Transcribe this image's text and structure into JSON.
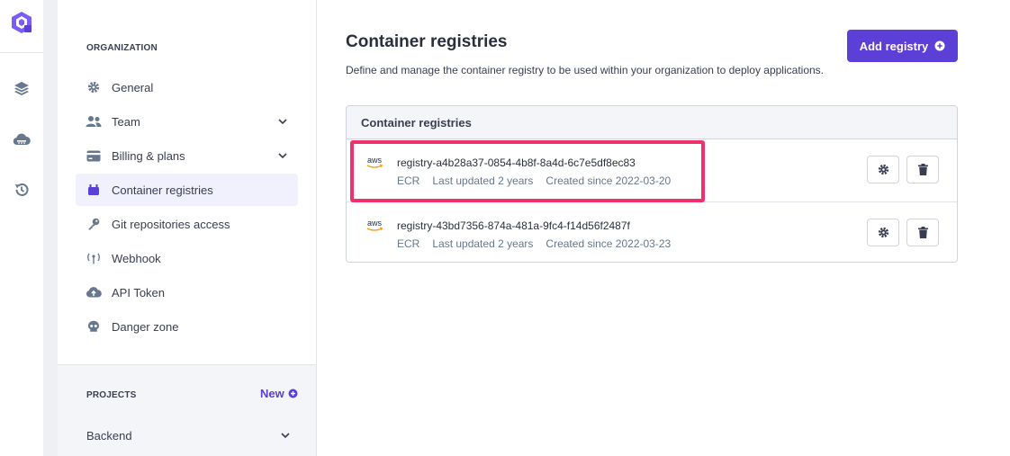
{
  "rail": {
    "logo_icon": "qovery-logo-icon",
    "items": [
      {
        "name": "layers-icon"
      },
      {
        "name": "cloud-icon"
      },
      {
        "name": "history-icon"
      }
    ]
  },
  "sidebar": {
    "organization_title": "Organization",
    "items": [
      {
        "label": "General",
        "icon": "gear-icon",
        "expandable": false,
        "active": false
      },
      {
        "label": "Team",
        "icon": "users-icon",
        "expandable": true,
        "active": false
      },
      {
        "label": "Billing & plans",
        "icon": "credit-card-icon",
        "expandable": true,
        "active": false
      },
      {
        "label": "Container registries",
        "icon": "box-icon",
        "expandable": false,
        "active": true
      },
      {
        "label": "Git repositories access",
        "icon": "key-icon",
        "expandable": false,
        "active": false
      },
      {
        "label": "Webhook",
        "icon": "antenna-icon",
        "expandable": false,
        "active": false
      },
      {
        "label": "API Token",
        "icon": "cloud-upload-icon",
        "expandable": false,
        "active": false
      },
      {
        "label": "Danger zone",
        "icon": "skull-icon",
        "expandable": false,
        "active": false
      }
    ],
    "projects_title": "Projects",
    "new_label": "New",
    "project": "Backend"
  },
  "main": {
    "title": "Container registries",
    "description": "Define and manage the container registry to be used within your organization to deploy applications.",
    "add_button": "Add registry",
    "panel_title": "Container registries",
    "registries": [
      {
        "provider": "aws",
        "name": "registry-a4b28a37-0854-4b8f-8a4d-6c7e5df8ec83",
        "kind": "ECR",
        "updated": "Last updated 2 years",
        "created": "Created since 2022-03-20"
      },
      {
        "provider": "aws",
        "name": "registry-43bd7356-874a-481a-9fc4-f14d56f2487f",
        "kind": "ECR",
        "updated": "Last updated 2 years",
        "created": "Created since 2022-03-23"
      }
    ]
  },
  "colors": {
    "accent": "#5b3fd6",
    "highlight": "#f0306a",
    "aws_orange": "#ff9900"
  }
}
